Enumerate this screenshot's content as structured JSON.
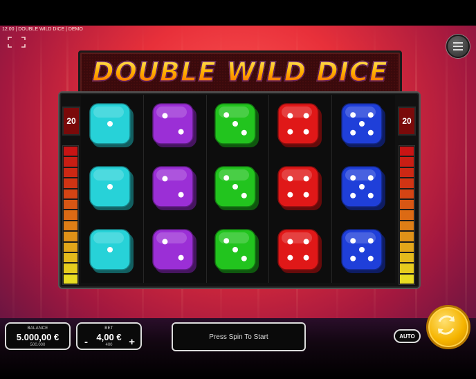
{
  "header": {
    "status": "12:00 | DOUBLE WILD DICE | DEMO"
  },
  "game": {
    "title": "DOUBLE WILD DICE",
    "lines_left": "20",
    "lines_right": "20",
    "reels": [
      {
        "color": "#27d2d8",
        "faces": [
          1,
          1,
          1
        ]
      },
      {
        "color": "#9b2fd6",
        "faces": [
          2,
          2,
          2
        ]
      },
      {
        "color": "#22c41e",
        "faces": [
          3,
          3,
          3
        ]
      },
      {
        "color": "#e01818",
        "faces": [
          4,
          4,
          4
        ]
      },
      {
        "color": "#1f3fd9",
        "faces": [
          5,
          5,
          5
        ]
      }
    ]
  },
  "footer": {
    "balance_label": "BALANCE",
    "balance_value": "5.000,00 €",
    "balance_sub": "500.000",
    "bet_label": "BET",
    "bet_value": "4,00 €",
    "bet_sub": "400",
    "bet_minus": "-",
    "bet_plus": "+",
    "message": "Press Spin To Start",
    "auto_label": "AUTO"
  },
  "icons": {
    "fullscreen": "fullscreen-icon",
    "menu": "menu-icon",
    "spin": "spin-icon"
  }
}
